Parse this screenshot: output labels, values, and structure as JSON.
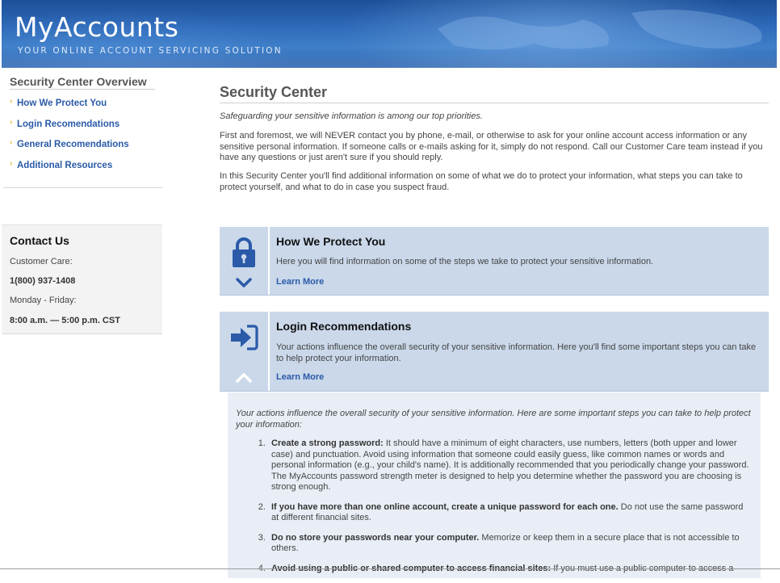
{
  "header": {
    "brand": "MyAccounts",
    "tagline": "YOUR ONLINE ACCOUNT SERVICING SOLUTION",
    "colors": {
      "primary": "#2c67b6",
      "dark": "#1d4f98"
    }
  },
  "sidebar": {
    "title": "Security Center Overview",
    "items": [
      {
        "label": "How We Protect You"
      },
      {
        "label": "Login Recomendations"
      },
      {
        "label": "General Recomendations"
      },
      {
        "label": "Additional Resources"
      }
    ]
  },
  "contact": {
    "title": "Contact Us",
    "care_label": "Customer Care:",
    "phone": "1(800) 937-1408",
    "days": "Monday - Friday:",
    "hours": "8:00 a.m. — 5:00 p.m. CST"
  },
  "main": {
    "title": "Security Center",
    "tagline": "Safeguarding your sensitive information is among our top priorities.",
    "para1": "First and foremost, we will NEVER contact you by phone, e-mail, or otherwise to ask for your online account access information or any sensitive personal information. If someone calls or e-mails asking for it, simply do not respond. Call our Customer Care team instead if you have any questions or just aren't sure if you should reply.",
    "para2": "In this Security Center you'll find additional information on some of what we do to protect your information, what steps you can take to protect yourself, and what to do in case you suspect fraud."
  },
  "cards": [
    {
      "title": "How We Protect You",
      "desc": "Here you will find information on some of the steps we take to protect your sensitive information.",
      "link": "Learn More",
      "icon": "lock-icon",
      "toggle_icon": "chevron-down-icon"
    },
    {
      "title": "Login Recommendations",
      "desc": "Your actions influence the overall security of your sensitive information. Here you'll find some important steps you can take to help protect your information.",
      "link": "Learn More",
      "icon": "sign-in-icon",
      "toggle_icon": "chevron-up-icon"
    }
  ],
  "expanded": {
    "intro": "Your actions influence the overall security of your sensitive information. Here are some important steps you can take to help protect your information:",
    "items": [
      {
        "bold": "Create a strong password:",
        "text": " It should have a minimum of eight characters, use numbers, letters (both upper and lower case) and punctuation. Avoid using information that someone could easily guess, like common names or words and personal information (e.g., your child's name). It is additionally recommended that you periodically change your password. The MyAccounts password strength meter is designed to help you determine whether the password you are choosing is strong enough."
      },
      {
        "bold": "If you have more than one online account, create a unique password for each one.",
        "text": " Do not use the same password at different financial sites."
      },
      {
        "bold": "Do no store your passwords near your computer.",
        "text": " Memorize or keep them in a secure place that is not accessible to others."
      },
      {
        "bold": "Avoid using a public or shared computer to access financial sites:",
        "text": " If you must use a public computer to access a"
      }
    ]
  }
}
